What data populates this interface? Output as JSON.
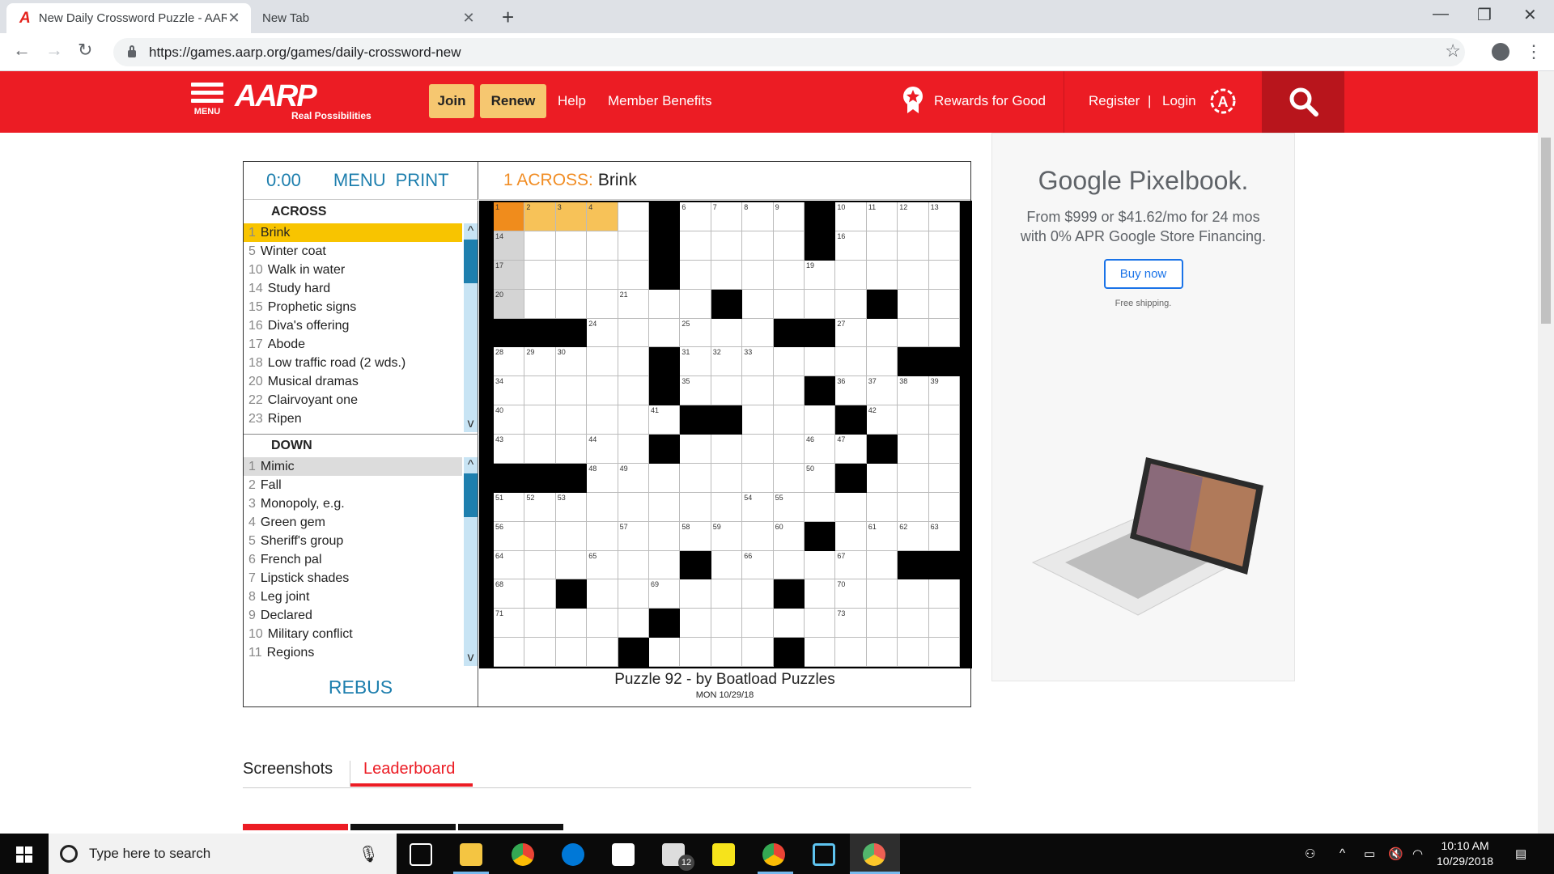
{
  "browser": {
    "tabs": [
      {
        "title": "New Daily Crossword Puzzle - AARP",
        "active": true
      },
      {
        "title": "New Tab",
        "active": false
      }
    ],
    "url": "https://games.aarp.org/games/daily-crossword-new"
  },
  "header": {
    "menu_label": "MENU",
    "logo": "AARP",
    "tagline": "Real Possibilities",
    "join": "Join",
    "renew": "Renew",
    "help": "Help",
    "member_benefits": "Member Benefits",
    "rewards": "Rewards for Good",
    "register": "Register",
    "login": "Login",
    "accent_color": "#ec1c24",
    "button_color": "#f6c770"
  },
  "crossword": {
    "timer": "0:00",
    "menu": "MENU",
    "print": "PRINT",
    "current_clue_number": "1 ACROSS:",
    "current_clue_text": "Brink",
    "across_heading": "ACROSS",
    "down_heading": "DOWN",
    "across": [
      {
        "n": "1",
        "text": "Brink"
      },
      {
        "n": "5",
        "text": "Winter coat"
      },
      {
        "n": "10",
        "text": "Walk in water"
      },
      {
        "n": "14",
        "text": "Study hard"
      },
      {
        "n": "15",
        "text": "Prophetic signs"
      },
      {
        "n": "16",
        "text": "Diva's offering"
      },
      {
        "n": "17",
        "text": "Abode"
      },
      {
        "n": "18",
        "text": "Low traffic road (2 wds.)"
      },
      {
        "n": "20",
        "text": "Musical dramas"
      },
      {
        "n": "22",
        "text": "Clairvoyant one"
      },
      {
        "n": "23",
        "text": "Ripen"
      }
    ],
    "down": [
      {
        "n": "1",
        "text": "Mimic"
      },
      {
        "n": "2",
        "text": "Fall"
      },
      {
        "n": "3",
        "text": "Monopoly, e.g."
      },
      {
        "n": "4",
        "text": "Green gem"
      },
      {
        "n": "5",
        "text": "Sheriff's group"
      },
      {
        "n": "6",
        "text": "French pal"
      },
      {
        "n": "7",
        "text": "Lipstick shades"
      },
      {
        "n": "8",
        "text": "Leg joint"
      },
      {
        "n": "9",
        "text": "Declared"
      },
      {
        "n": "10",
        "text": "Military conflict"
      },
      {
        "n": "11",
        "text": "Regions"
      }
    ],
    "rebus": "REBUS",
    "puzzle_title": "Puzzle 92 - by Boatload Puzzles",
    "puzzle_date": "MON 10/29/18",
    "grid_rows": [
      ".....#....#....",
      ".....#....#....",
      ".....#.........",
      ".......#....#..",
      "###......##....",
      ".....#.......##",
      ".....#....#....",
      "......##...#...",
      ".....#......#..",
      "###........#...",
      "...............",
      "..........#....",
      "......#......##",
      "..#......#.....",
      ".....#.........",
      "....#....#....."
    ],
    "grid_numbers": [
      [
        0,
        0,
        "1"
      ],
      [
        0,
        1,
        "2"
      ],
      [
        0,
        2,
        "3"
      ],
      [
        0,
        3,
        "4"
      ],
      [
        0,
        5,
        "5"
      ],
      [
        0,
        6,
        "6"
      ],
      [
        0,
        7,
        "7"
      ],
      [
        0,
        8,
        "8"
      ],
      [
        0,
        9,
        "9"
      ],
      [
        0,
        11,
        "10"
      ],
      [
        0,
        12,
        "11"
      ],
      [
        0,
        13,
        "12"
      ],
      [
        0,
        14,
        "13"
      ],
      [
        1,
        0,
        "14"
      ],
      [
        1,
        5,
        "15"
      ],
      [
        1,
        11,
        "16"
      ],
      [
        2,
        0,
        "17"
      ],
      [
        2,
        5,
        "18"
      ],
      [
        2,
        10,
        "19"
      ],
      [
        3,
        0,
        "20"
      ],
      [
        3,
        4,
        "21"
      ],
      [
        3,
        7,
        "22"
      ],
      [
        3,
        12,
        "23"
      ],
      [
        4,
        3,
        "24"
      ],
      [
        4,
        6,
        "25"
      ],
      [
        4,
        9,
        "26"
      ],
      [
        4,
        11,
        "27"
      ],
      [
        5,
        0,
        "28"
      ],
      [
        5,
        1,
        "29"
      ],
      [
        5,
        2,
        "30"
      ],
      [
        5,
        6,
        "31"
      ],
      [
        5,
        7,
        "32"
      ],
      [
        5,
        8,
        "33"
      ],
      [
        6,
        0,
        "34"
      ],
      [
        6,
        6,
        "35"
      ],
      [
        6,
        11,
        "36"
      ],
      [
        6,
        12,
        "37"
      ],
      [
        6,
        13,
        "38"
      ],
      [
        6,
        14,
        "39"
      ],
      [
        7,
        0,
        "40"
      ],
      [
        7,
        5,
        "41"
      ],
      [
        7,
        12,
        "42"
      ],
      [
        8,
        0,
        "43"
      ],
      [
        8,
        3,
        "44"
      ],
      [
        8,
        5,
        "45"
      ],
      [
        8,
        10,
        "46"
      ],
      [
        8,
        11,
        "47"
      ],
      [
        9,
        3,
        "48"
      ],
      [
        9,
        4,
        "49"
      ],
      [
        9,
        10,
        "50"
      ],
      [
        10,
        0,
        "51"
      ],
      [
        10,
        1,
        "52"
      ],
      [
        10,
        2,
        "53"
      ],
      [
        10,
        8,
        "54"
      ],
      [
        10,
        9,
        "55"
      ],
      [
        11,
        0,
        "56"
      ],
      [
        11,
        4,
        "57"
      ],
      [
        11,
        6,
        "58"
      ],
      [
        11,
        7,
        "59"
      ],
      [
        11,
        9,
        "60"
      ],
      [
        11,
        12,
        "61"
      ],
      [
        11,
        13,
        "62"
      ],
      [
        11,
        14,
        "63"
      ],
      [
        12,
        0,
        "64"
      ],
      [
        12,
        3,
        "65"
      ],
      [
        12,
        8,
        "66"
      ],
      [
        12,
        11,
        "67"
      ],
      [
        13,
        0,
        "68"
      ],
      [
        13,
        5,
        "69"
      ],
      [
        13,
        11,
        "70"
      ],
      [
        14,
        0,
        "71"
      ],
      [
        14,
        5,
        "72"
      ],
      [
        14,
        11,
        "73"
      ]
    ]
  },
  "ad": {
    "title": "Google Pixelbook.",
    "subtitle_line1": "From $999 or $41.62/mo for 24 mos",
    "subtitle_line2": "with 0% APR Google Store Financing.",
    "button": "Buy now",
    "shipping": "Free shipping."
  },
  "bottom_tabs": {
    "screenshots": "Screenshots",
    "leaderboard": "Leaderboard"
  },
  "taskbar": {
    "search_placeholder": "Type here to search",
    "badge": "12",
    "time": "10:10 AM",
    "date": "10/29/2018"
  }
}
